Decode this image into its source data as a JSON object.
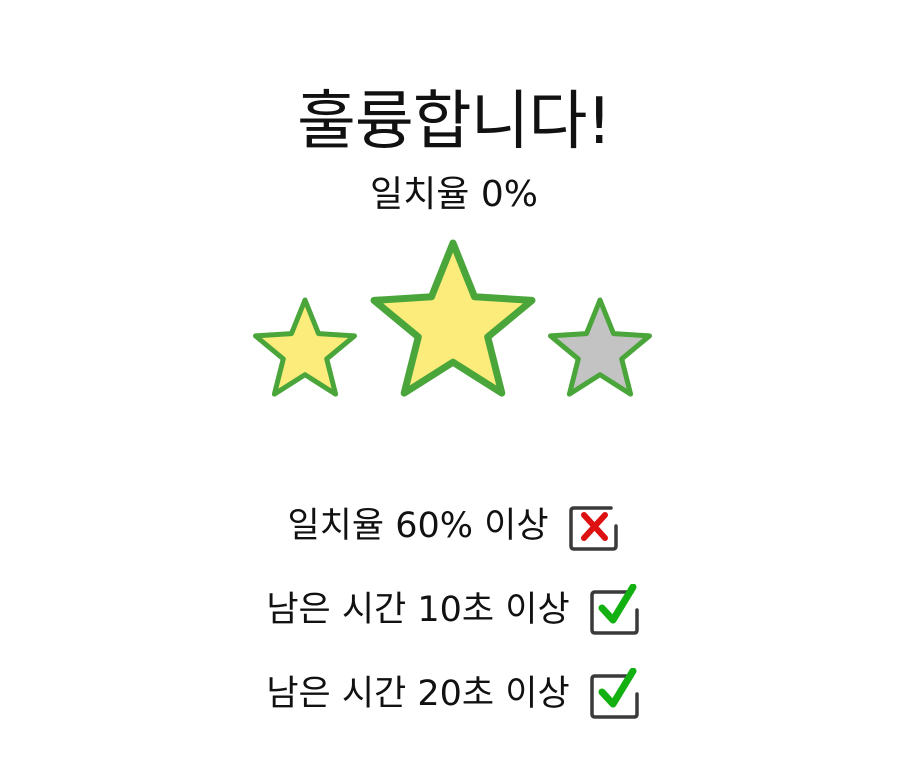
{
  "result": {
    "title": "훌륭합니다!",
    "match_rate_text": "일치율 0%",
    "stars": [
      {
        "icon": "star-icon",
        "earned": true
      },
      {
        "icon": "star-icon",
        "earned": true
      },
      {
        "icon": "star-icon",
        "earned": false
      }
    ],
    "conditions": [
      {
        "label": "일치율 60% 이상",
        "met": false,
        "icon": "cross-mark-icon"
      },
      {
        "label": "남은 시간 10초 이상",
        "met": true,
        "icon": "check-mark-icon"
      },
      {
        "label": "남은 시간 20초 이상",
        "met": true,
        "icon": "check-mark-icon"
      }
    ]
  },
  "colors": {
    "star_earned_fill": "#fcec7c",
    "star_empty_fill": "#c3c3c3",
    "star_outline": "#4aa63a",
    "check_green": "#13b012",
    "cross_red": "#dd1111",
    "checkbox_border": "#3a3a3a"
  }
}
